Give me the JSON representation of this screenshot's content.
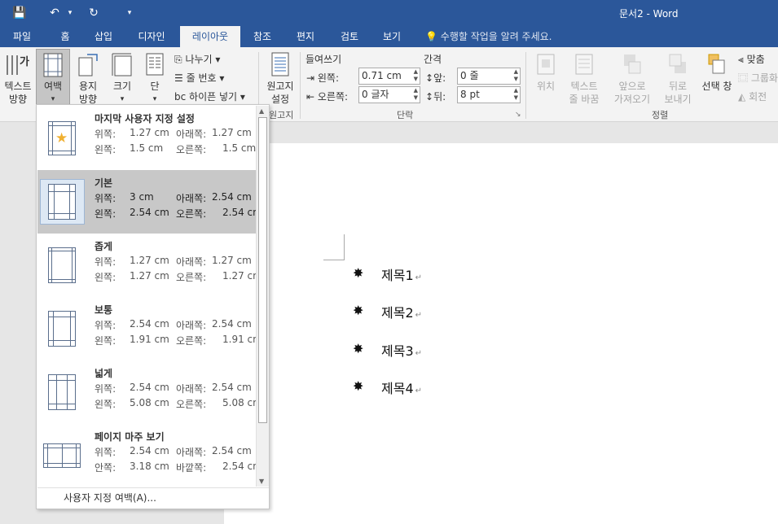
{
  "window": {
    "title": "문서2 - Word"
  },
  "quick_access": {
    "save": "💾",
    "undo": "↶",
    "undo_dd": "▾",
    "redo": "↻",
    "customize": "▾"
  },
  "tabs": [
    "파일",
    "홈",
    "삽입",
    "디자인",
    "레이아웃",
    "참조",
    "편지",
    "검토",
    "보기"
  ],
  "tell_me": "수행할 작업을 알려 주세요.",
  "ribbon": {
    "text_dir": [
      "텍스트",
      "방향"
    ],
    "margins": [
      "여백",
      "▾"
    ],
    "orientation": [
      "용지",
      "방향"
    ],
    "size": [
      "크기",
      "▾"
    ],
    "columns": [
      "단",
      "▾"
    ],
    "breaks": "나누기",
    "line_numbers": "줄 번호",
    "hyphenation": "하이픈 넣기",
    "manuscript": [
      "원고지",
      "설정"
    ],
    "manuscript_group": "원고지",
    "indent_title": "들여쓰기",
    "spacing_title": "간격",
    "left_label": "왼쪽:",
    "left_value": "0.71 cm",
    "right_label": "오른쪽:",
    "right_value": "0 글자",
    "before_label": "앞:",
    "before_value": "0 줄",
    "after_label": "뒤:",
    "after_value": "8 pt",
    "paragraph_group": "단락",
    "position": "위치",
    "wrap_text": [
      "텍스트",
      "줄 바꿈"
    ],
    "bring_forward": [
      "앞으로",
      "가져오기"
    ],
    "send_backward": [
      "뒤로",
      "보내기"
    ],
    "selection_pane": "선택 창",
    "align": "맞춤",
    "group": "그룹화",
    "rotate": "회전",
    "arrange_group": "정렬"
  },
  "margins_menu": {
    "items": [
      {
        "name": "마지막 사용자 지정 설정",
        "r1l": "위쪽:",
        "r1v": "1.27 cm",
        "r1rl": "아래쪽:",
        "r1rv": "1.27 cm",
        "r2l": "왼쪽:",
        "r2v": "1.5 cm",
        "r2rl": "오른쪽:",
        "r2rv": "1.5 cm"
      },
      {
        "name": "기본",
        "r1l": "위쪽:",
        "r1v": "3 cm",
        "r1rl": "아래쪽:",
        "r1rv": "2.54 cm",
        "r2l": "왼쪽:",
        "r2v": "2.54 cm",
        "r2rl": "오른쪽:",
        "r2rv": "2.54 cm"
      },
      {
        "name": "좁게",
        "r1l": "위쪽:",
        "r1v": "1.27 cm",
        "r1rl": "아래쪽:",
        "r1rv": "1.27 cm",
        "r2l": "왼쪽:",
        "r2v": "1.27 cm",
        "r2rl": "오른쪽:",
        "r2rv": "1.27 cm"
      },
      {
        "name": "보통",
        "r1l": "위쪽:",
        "r1v": "2.54 cm",
        "r1rl": "아래쪽:",
        "r1rv": "2.54 cm",
        "r2l": "왼쪽:",
        "r2v": "1.91 cm",
        "r2rl": "오른쪽:",
        "r2rv": "1.91 cm"
      },
      {
        "name": "넓게",
        "r1l": "위쪽:",
        "r1v": "2.54 cm",
        "r1rl": "아래쪽:",
        "r1rv": "2.54 cm",
        "r2l": "왼쪽:",
        "r2v": "5.08 cm",
        "r2rl": "오른쪽:",
        "r2rv": "5.08 cm"
      },
      {
        "name": "페이지 마주 보기",
        "r1l": "위쪽:",
        "r1v": "2.54 cm",
        "r1rl": "아래쪽:",
        "r1rv": "2.54 cm",
        "r2l": "안쪽:",
        "r2v": "3.18 cm",
        "r2rl": "바깥쪽:",
        "r2rv": "2.54 cm"
      }
    ],
    "custom": "사용자 지정 여백(A)..."
  },
  "document": {
    "bullets": [
      "제목1",
      "제목2",
      "제목3",
      "제목4"
    ],
    "bullet_symbol": "✸",
    "return_mark": "↵"
  }
}
